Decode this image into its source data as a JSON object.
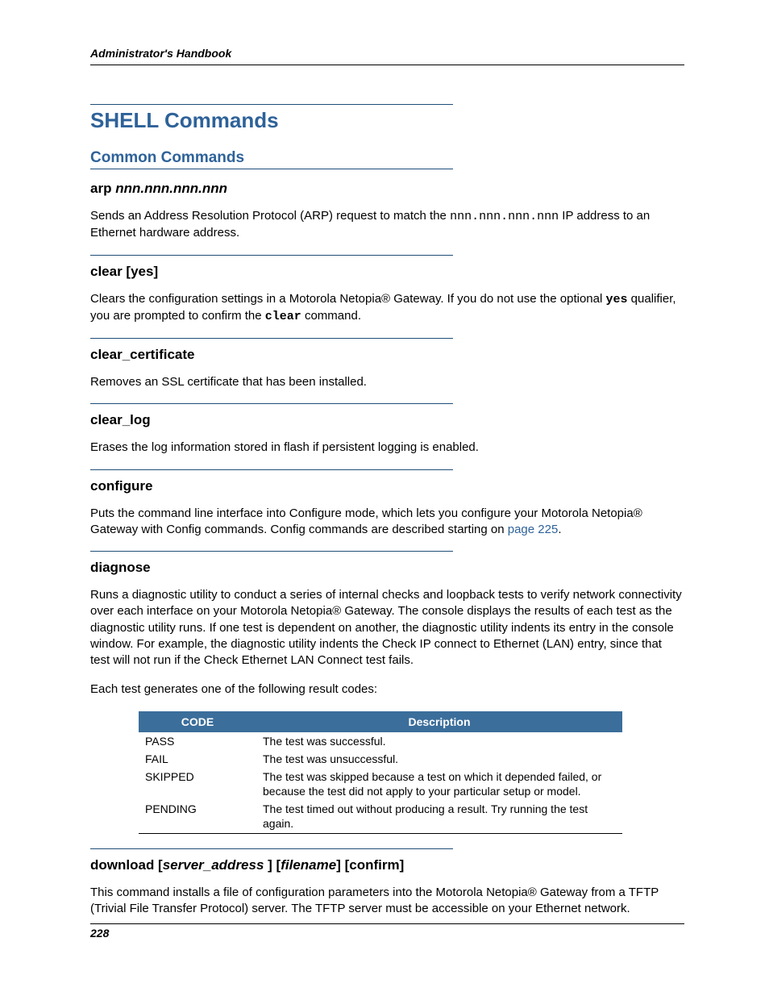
{
  "header": {
    "running_head": "Administrator's Handbook"
  },
  "title": "SHELL Commands",
  "subtitle": "Common Commands",
  "cmds": {
    "arp": {
      "name": "arp ",
      "arg": "nnn.nnn.nnn.nnn",
      "desc_pre": "Sends an Address Resolution Protocol (ARP) request to match the ",
      "desc_mono": "nnn.nnn.nnn.nnn",
      "desc_post": " IP address to an Ethernet hardware address."
    },
    "clear": {
      "name": "clear [yes]",
      "desc_pre": "Clears the configuration settings in a Motorola Netopia® Gateway. If you do not use the optional ",
      "desc_yes": "yes",
      "desc_mid": " qualifier, you are prompted to confirm the ",
      "desc_clear": "clear",
      "desc_post": " command."
    },
    "clear_cert": {
      "name": "clear_certificate",
      "desc": "Removes an SSL certificate that has been installed."
    },
    "clear_log": {
      "name": "clear_log",
      "desc": "Erases the log information stored in flash if persistent logging is enabled."
    },
    "configure": {
      "name": "configure",
      "desc_pre": "Puts the command line interface into Configure mode, which lets you configure your Motorola Netopia® Gateway with Config commands. Config commands are described starting on ",
      "link": "page 225",
      "desc_post": "."
    },
    "diagnose": {
      "name": "diagnose",
      "desc": "Runs a diagnostic utility to conduct a series of internal checks and loopback tests to verify network connectivity over each interface on your Motorola Netopia® Gateway. The console displays the results of each test as the diagnostic utility runs. If one test is dependent on another, the diagnostic utility indents its entry in the console window. For example, the diagnostic utility indents the Check IP connect to Ethernet (LAN) entry, since that test will not run if the Check Ethernet LAN Connect test fails.",
      "lead": "Each test generates one of the following result codes:"
    },
    "download": {
      "name_pre": "download [",
      "arg1": "server_address",
      "mid": " ] [",
      "arg2": "filename",
      "post": "] [confirm]",
      "desc": "This command installs a file of configuration parameters into the Motorola Netopia® Gateway from a TFTP (Trivial File Transfer Protocol) server. The TFTP server must be accessible on your Ethernet network."
    }
  },
  "table": {
    "head_code": "CODE",
    "head_desc": "Description",
    "rows": [
      {
        "code": "PASS",
        "desc": "The test was successful."
      },
      {
        "code": "FAIL",
        "desc": "The test was unsuccessful."
      },
      {
        "code": "SKIPPED",
        "desc": "The test was skipped because a test on which it depended failed, or because the test did not apply to your particular setup or model."
      },
      {
        "code": "PENDING",
        "desc": "The test timed out without producing a result. Try running the test again."
      }
    ]
  },
  "footer": {
    "page": "228"
  }
}
